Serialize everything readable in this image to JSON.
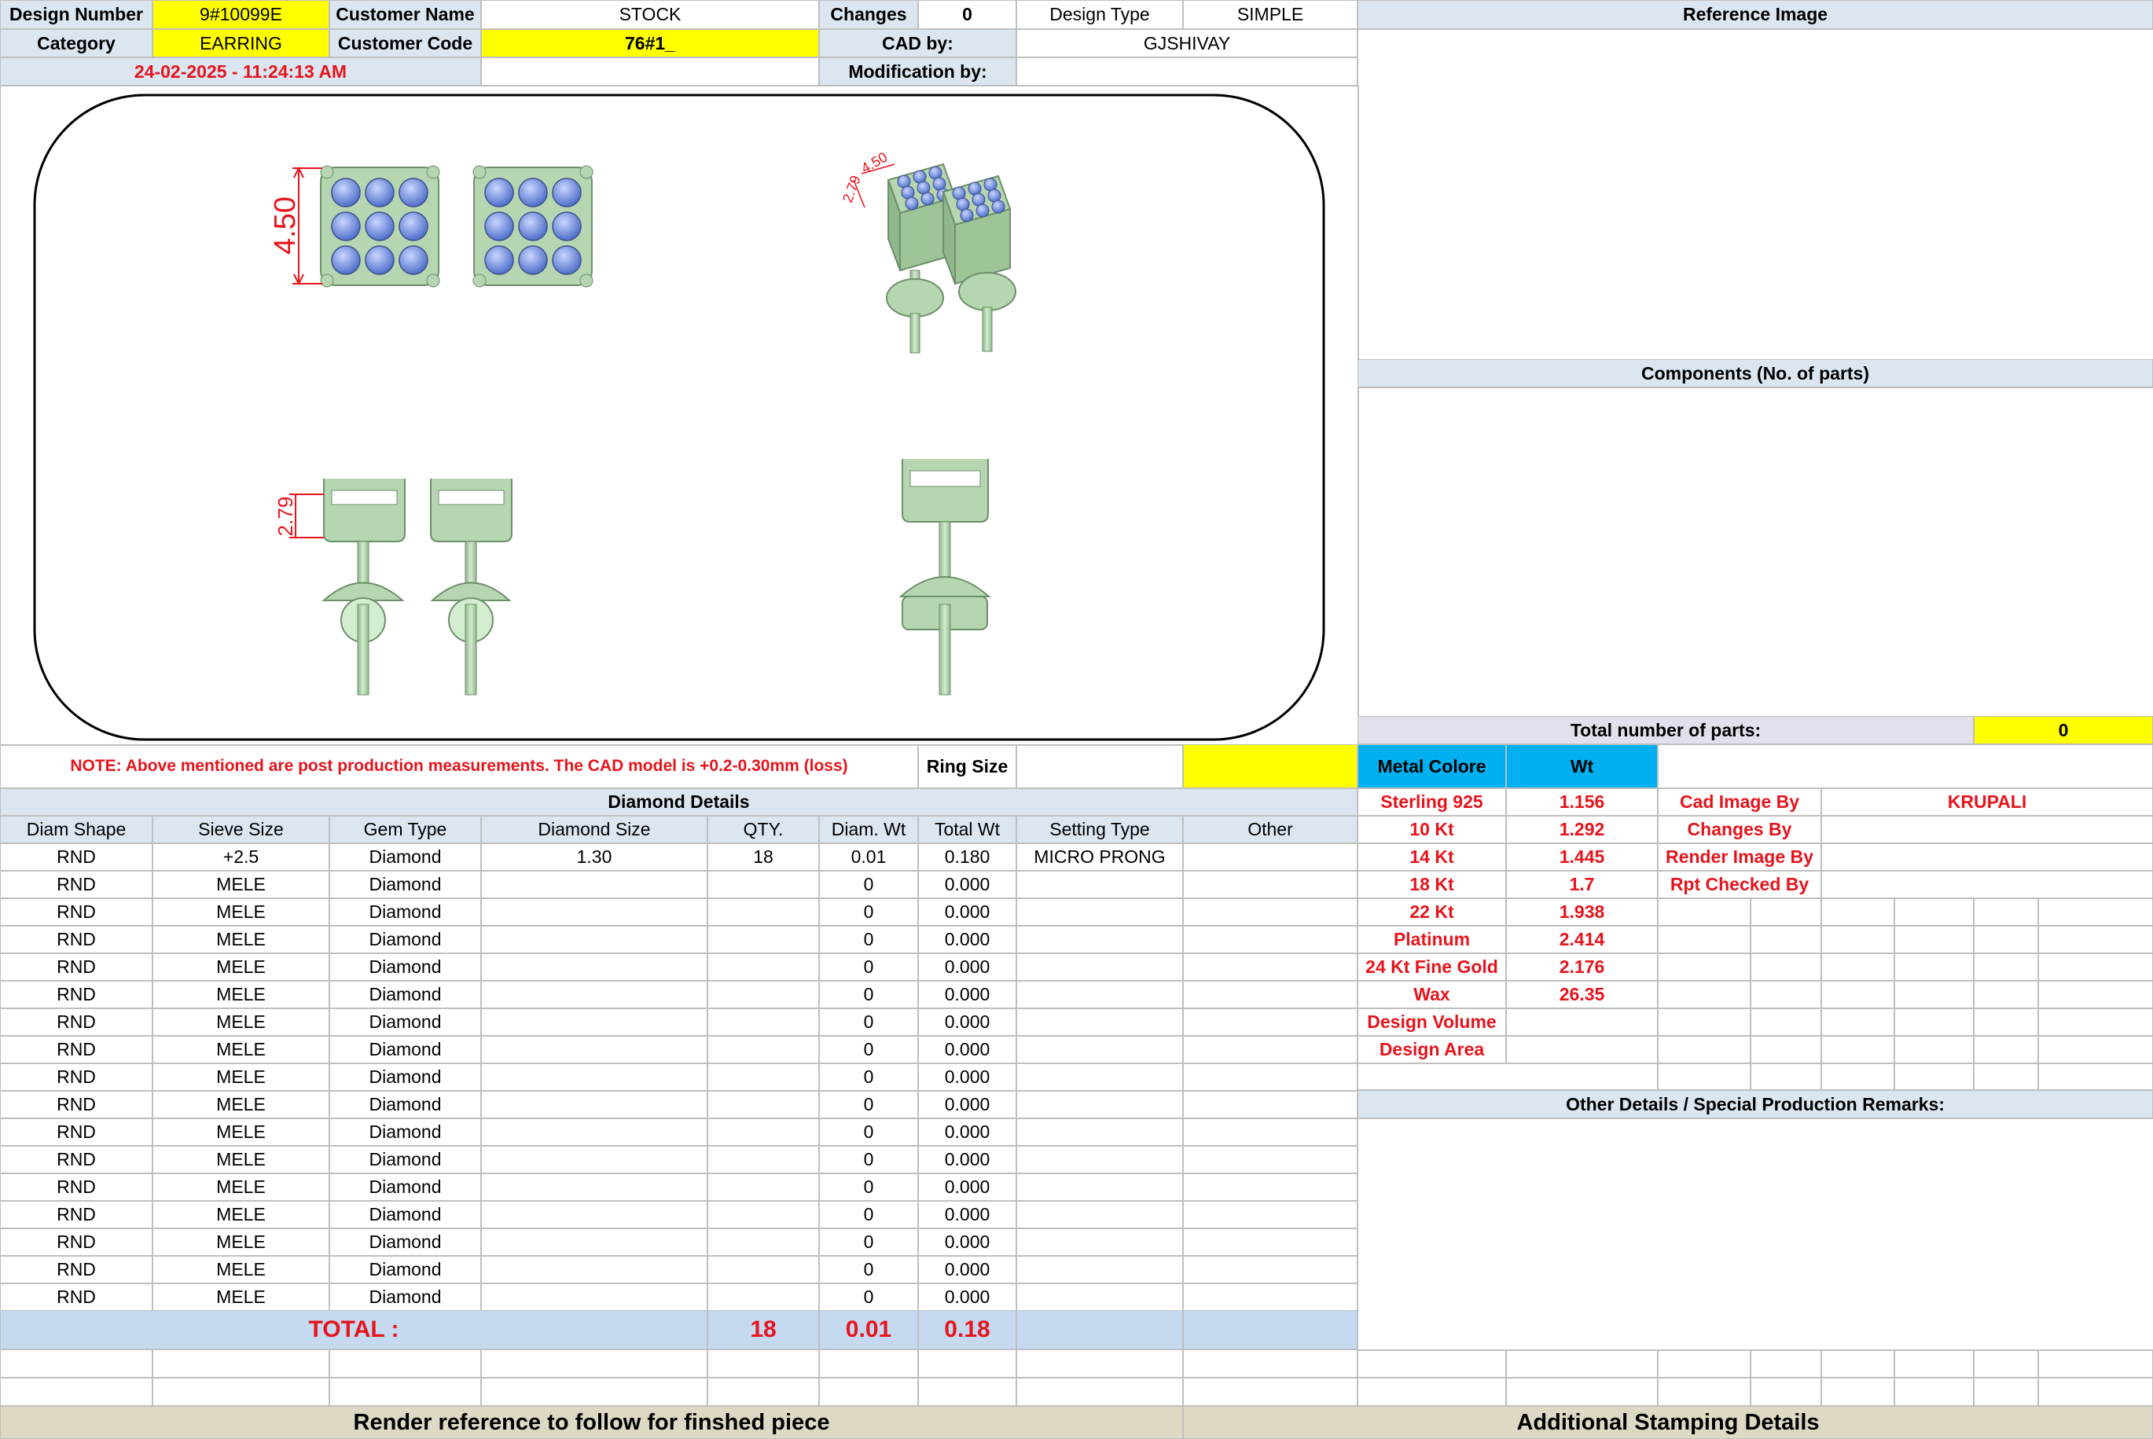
{
  "header": {
    "design_number_label": "Design Number",
    "design_number": "9#10099E",
    "customer_name_label": "Customer Name",
    "customer_name": "STOCK",
    "changes_label": "Changes",
    "changes": "0",
    "design_type_label": "Design Type",
    "design_type": "SIMPLE",
    "reference_image_label": "Reference Image",
    "category_label": "Category",
    "category": "EARRING",
    "customer_code_label": "Customer Code",
    "customer_code": "76#1_",
    "cad_by_label": "CAD by:",
    "cad_by": "GJSHIVAY",
    "timestamp": "24-02-2025 - 11:24:13 AM",
    "modification_by_label": "Modification by:",
    "modification_by": ""
  },
  "drawing": {
    "dim_top_width": "4.50",
    "dim_side_height": "2.79",
    "dim_iso_height": "2.79",
    "dim_iso_width": "4.50"
  },
  "components": {
    "title": "Components (No. of parts)",
    "total_label": "Total number of parts:",
    "total_value": "0"
  },
  "note": "NOTE: Above mentioned are post production measurements. The CAD model is +0.2-0.30mm (loss)",
  "ring_size_label": "Ring Size",
  "ring_size": "",
  "metal": {
    "header_label": "Metal Colore",
    "header_wt": "Wt",
    "rows": [
      {
        "name": "Sterling 925",
        "wt": "1.156"
      },
      {
        "name": "10 Kt",
        "wt": "1.292"
      },
      {
        "name": "14 Kt",
        "wt": "1.445"
      },
      {
        "name": "18 Kt",
        "wt": "1.7"
      },
      {
        "name": "22 Kt",
        "wt": "1.938"
      },
      {
        "name": "Platinum",
        "wt": "2.414"
      },
      {
        "name": "24 Kt Fine Gold",
        "wt": "2.176"
      },
      {
        "name": "Wax",
        "wt": "26.35"
      },
      {
        "name": "Design Volume",
        "wt": ""
      },
      {
        "name": "Design Area",
        "wt": ""
      }
    ]
  },
  "credits": [
    {
      "label": "Cad Image By",
      "value": "KRUPALI"
    },
    {
      "label": "Changes By",
      "value": ""
    },
    {
      "label": "Render Image By",
      "value": ""
    },
    {
      "label": "Rpt Checked By",
      "value": ""
    }
  ],
  "other_details_title": "Other Details / Special Production Remarks:",
  "diamond": {
    "title": "Diamond Details",
    "columns": [
      "Diam Shape",
      "Sieve Size",
      "Gem Type",
      "Diamond Size",
      "QTY.",
      "Diam. Wt",
      "Total Wt",
      "Setting Type",
      "Other"
    ],
    "rows": [
      [
        "RND",
        "+2.5",
        "Diamond",
        "1.30",
        "18",
        "0.01",
        "0.180",
        "MICRO PRONG",
        ""
      ],
      [
        "RND",
        "MELE",
        "Diamond",
        "",
        "",
        "0",
        "0.000",
        "",
        ""
      ],
      [
        "RND",
        "MELE",
        "Diamond",
        "",
        "",
        "0",
        "0.000",
        "",
        ""
      ],
      [
        "RND",
        "MELE",
        "Diamond",
        "",
        "",
        "0",
        "0.000",
        "",
        ""
      ],
      [
        "RND",
        "MELE",
        "Diamond",
        "",
        "",
        "0",
        "0.000",
        "",
        ""
      ],
      [
        "RND",
        "MELE",
        "Diamond",
        "",
        "",
        "0",
        "0.000",
        "",
        ""
      ],
      [
        "RND",
        "MELE",
        "Diamond",
        "",
        "",
        "0",
        "0.000",
        "",
        ""
      ],
      [
        "RND",
        "MELE",
        "Diamond",
        "",
        "",
        "0",
        "0.000",
        "",
        ""
      ],
      [
        "RND",
        "MELE",
        "Diamond",
        "",
        "",
        "0",
        "0.000",
        "",
        ""
      ],
      [
        "RND",
        "MELE",
        "Diamond",
        "",
        "",
        "0",
        "0.000",
        "",
        ""
      ],
      [
        "RND",
        "MELE",
        "Diamond",
        "",
        "",
        "0",
        "0.000",
        "",
        ""
      ],
      [
        "RND",
        "MELE",
        "Diamond",
        "",
        "",
        "0",
        "0.000",
        "",
        ""
      ],
      [
        "RND",
        "MELE",
        "Diamond",
        "",
        "",
        "0",
        "0.000",
        "",
        ""
      ],
      [
        "RND",
        "MELE",
        "Diamond",
        "",
        "",
        "0",
        "0.000",
        "",
        ""
      ],
      [
        "RND",
        "MELE",
        "Diamond",
        "",
        "",
        "0",
        "0.000",
        "",
        ""
      ],
      [
        "RND",
        "MELE",
        "Diamond",
        "",
        "",
        "0",
        "0.000",
        "",
        ""
      ],
      [
        "RND",
        "MELE",
        "Diamond",
        "",
        "",
        "0",
        "0.000",
        "",
        ""
      ]
    ],
    "total_label": "TOTAL :",
    "total_qty": "18",
    "total_diam_wt": "0.01",
    "total_wt": "0.18"
  },
  "footer": {
    "render_reference": "Render reference to follow for finshed piece",
    "stamping": "Additional Stamping Details"
  },
  "colors": {
    "header_blue": "#dce6f1",
    "highlight_yellow": "#ffff00",
    "label_red": "#e6141c",
    "metal_header_cyan": "#00b0f0",
    "total_row_blue": "#c5d9f1",
    "footer_tan": "#ddd9c4",
    "parts_lavender": "#e4dfec",
    "model_green": "#b5d6b0",
    "stone_blue": "#7b93d6"
  }
}
